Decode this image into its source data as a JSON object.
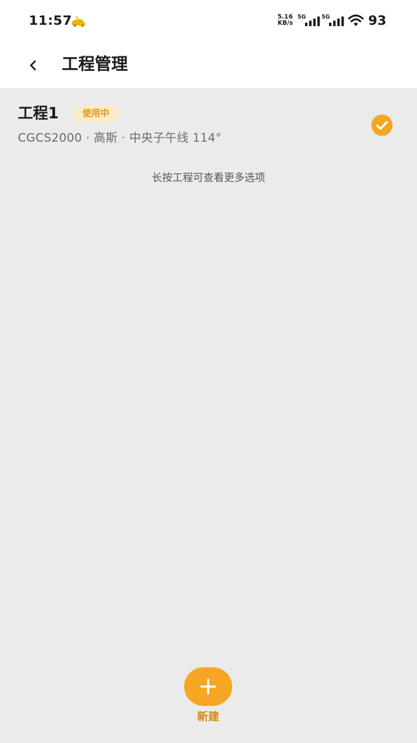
{
  "status_bar": {
    "time": "11:57",
    "net_speed_value": "5.16",
    "net_speed_unit": "KB/s",
    "sim1_gen": "5G",
    "sim2_gen": "5G",
    "battery": "93",
    "app_icon": "car-notification-icon"
  },
  "header": {
    "back_icon": "chevron-left-icon",
    "title": "工程管理"
  },
  "projects": [
    {
      "name": "工程1",
      "badge": "使用中",
      "meta": "CGCS2000 · 高斯 · 中央子午线 114°",
      "selected": true
    }
  ],
  "hint": "长按工程可查看更多选项",
  "fab": {
    "icon": "plus-icon",
    "label": "新建"
  },
  "colors": {
    "accent": "#f5a623",
    "accent_text": "#d68b16",
    "badge_bg": "#fbecc9",
    "background": "#ebebeb"
  }
}
